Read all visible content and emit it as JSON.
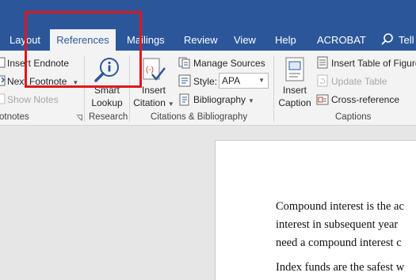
{
  "tabs": {
    "layout": "Layout",
    "references": "References",
    "mailings": "Mailings",
    "review": "Review",
    "view": "View",
    "help": "Help",
    "acrobat": "ACROBAT",
    "tell": "Tell"
  },
  "ribbon": {
    "footnotes": {
      "insert_endnote": "Insert Endnote",
      "next_footnote": "Next Footnote",
      "show_notes": "Show Notes",
      "group_label": "otnotes"
    },
    "research": {
      "smart_lookup_line1": "Smart",
      "smart_lookup_line2": "Lookup",
      "group_label": "Research"
    },
    "citations": {
      "insert_citation_line1": "Insert",
      "insert_citation_line2": "Citation",
      "manage_sources": "Manage Sources",
      "style_label": "Style:",
      "style_value": "APA",
      "bibliography": "Bibliography",
      "group_label": "Citations & Bibliography"
    },
    "captions": {
      "insert_caption_line1": "Insert",
      "insert_caption_line2": "Caption",
      "insert_table_of_figures": "Insert Table of Figure",
      "update_table": "Update Table",
      "cross_reference": "Cross-reference",
      "group_label": "Captions"
    }
  },
  "document": {
    "lines": [
      "Compound interest is the ac",
      "interest in subsequent year",
      "need a compound interest c",
      "Index funds are the safest w"
    ]
  },
  "colors": {
    "title_bar": "#2b579a",
    "ribbon_bg": "#f3f3f3",
    "highlight": "#e0161d"
  }
}
